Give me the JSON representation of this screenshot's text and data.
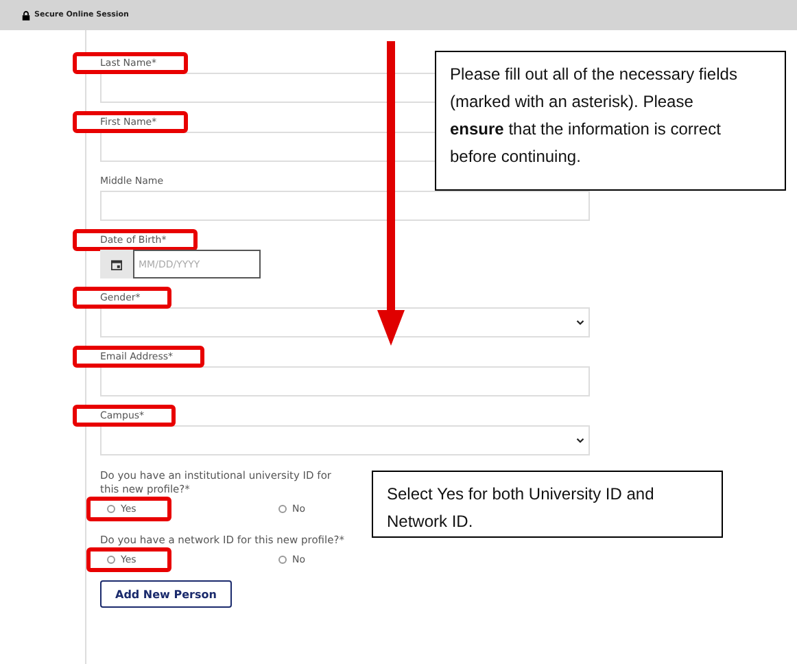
{
  "header": {
    "title": "Secure Online Session"
  },
  "fields": [
    {
      "kind": "text",
      "label": "Last Name*",
      "highlighted": true
    },
    {
      "kind": "text",
      "label": "First Name*",
      "highlighted": true
    },
    {
      "kind": "text",
      "label": "Middle Name",
      "highlighted": false
    },
    {
      "kind": "date",
      "label": "Date of Birth*",
      "placeholder": "MM/DD/YYYY",
      "highlighted": true
    },
    {
      "kind": "select",
      "label": "Gender*",
      "highlighted": true
    },
    {
      "kind": "text",
      "label": "Email Address*",
      "highlighted": true
    },
    {
      "kind": "select",
      "label": "Campus*",
      "highlighted": true
    }
  ],
  "questions": [
    {
      "text": "Do you have an institutional university ID for this new profile?*",
      "options": [
        {
          "label": "Yes",
          "selected": false,
          "highlighted": true
        },
        {
          "label": "No",
          "selected": false,
          "highlighted": false
        }
      ]
    },
    {
      "text": "Do you have a network ID for this new profile?*",
      "options": [
        {
          "label": "Yes",
          "selected": false,
          "highlighted": true
        },
        {
          "label": "No",
          "selected": false,
          "highlighted": false
        }
      ]
    }
  ],
  "button": "Add New Person",
  "callouts": [
    {
      "text": "Please fill out all of the necessary fields (marked with an asterisk). Please **ensure** that the information is correct before continuing."
    },
    {
      "text": "Select Yes for both University ID and Network ID."
    }
  ]
}
